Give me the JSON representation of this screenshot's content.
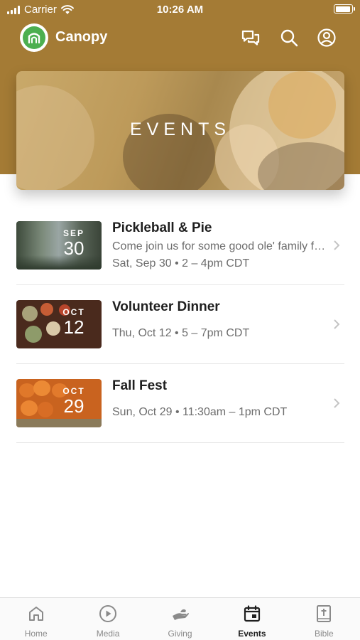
{
  "status_bar": {
    "carrier": "Carrier",
    "time": "10:26 AM"
  },
  "header": {
    "app_name": "Canopy"
  },
  "banner": {
    "title": "EVENTS"
  },
  "events": [
    {
      "month": "SEP",
      "day": "30",
      "title": "Pickleball & Pie",
      "description": "Come join us for some good ole' family fun...",
      "datetime": "Sat, Sep 30 • 2 – 4pm CDT"
    },
    {
      "month": "OCT",
      "day": "12",
      "title": "Volunteer Dinner",
      "description": "",
      "datetime": "Thu, Oct 12 • 5 – 7pm CDT"
    },
    {
      "month": "OCT",
      "day": "29",
      "title": "Fall Fest",
      "description": "",
      "datetime": "Sun, Oct 29 • 11:30am – 1pm CDT"
    }
  ],
  "tabs": [
    {
      "label": "Home",
      "icon": "home-icon"
    },
    {
      "label": "Media",
      "icon": "play-icon"
    },
    {
      "label": "Giving",
      "icon": "giving-hand-icon"
    },
    {
      "label": "Events",
      "icon": "calendar-icon",
      "active": true
    },
    {
      "label": "Bible",
      "icon": "bible-icon"
    }
  ],
  "colors": {
    "header": "#a47b35",
    "logo": "#4caf50",
    "active_tab": "#1f1f1f",
    "inactive_tab": "#8a8a8a"
  }
}
